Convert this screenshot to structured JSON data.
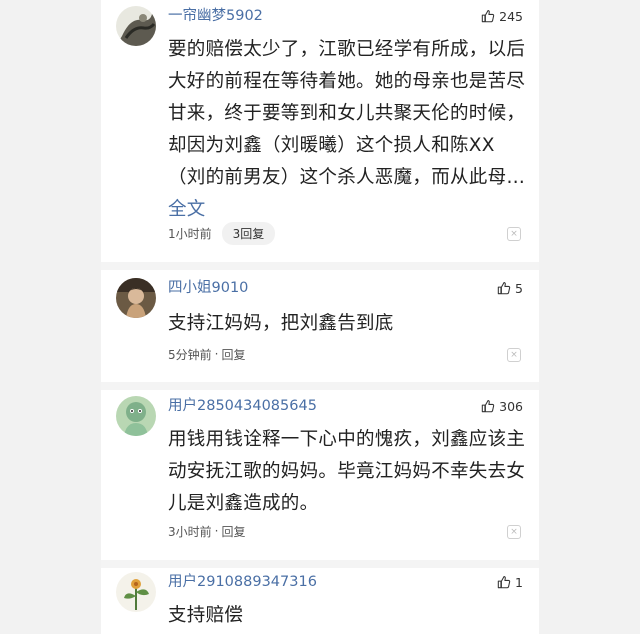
{
  "comments": [
    {
      "username": "一帘幽梦5902",
      "likes": "245",
      "content": "要的赔偿太少了，江歌已经学有所成，以后大好的前程在等待着她。她的母亲也是苦尽甘来，终于要等到和女儿共聚天伦的时候，却因为刘鑫（刘暖曦）这个损人和陈XX（刘的前男友）这个杀人恶魔，而从此母…",
      "more_label": "全文",
      "time": "1小时前",
      "reply_label": "3回复",
      "close_glyph": "×"
    },
    {
      "username": "四小姐9010",
      "likes": "5",
      "content": "支持江妈妈，把刘鑫告到底",
      "time": "5分钟前",
      "separator": "·",
      "reply_label": "回复",
      "close_glyph": "×"
    },
    {
      "username": "用户2850434085645",
      "likes": "306",
      "content": "用钱用钱诠释一下心中的愧疚，刘鑫应该主动安抚江歌的妈妈。毕竟江妈妈不幸失去女儿是刘鑫造成的。",
      "time": "3小时前",
      "separator": "·",
      "reply_label": "回复",
      "close_glyph": "×"
    },
    {
      "username": "用户2910889347316",
      "likes": "1",
      "content": "支持赔偿"
    }
  ],
  "icons": {
    "like": "thumbs-up-icon",
    "close": "close-icon"
  },
  "colors": {
    "username": "#4a6fa5",
    "text": "#222222",
    "background": "#f2f2f2",
    "panel": "#ffffff"
  }
}
